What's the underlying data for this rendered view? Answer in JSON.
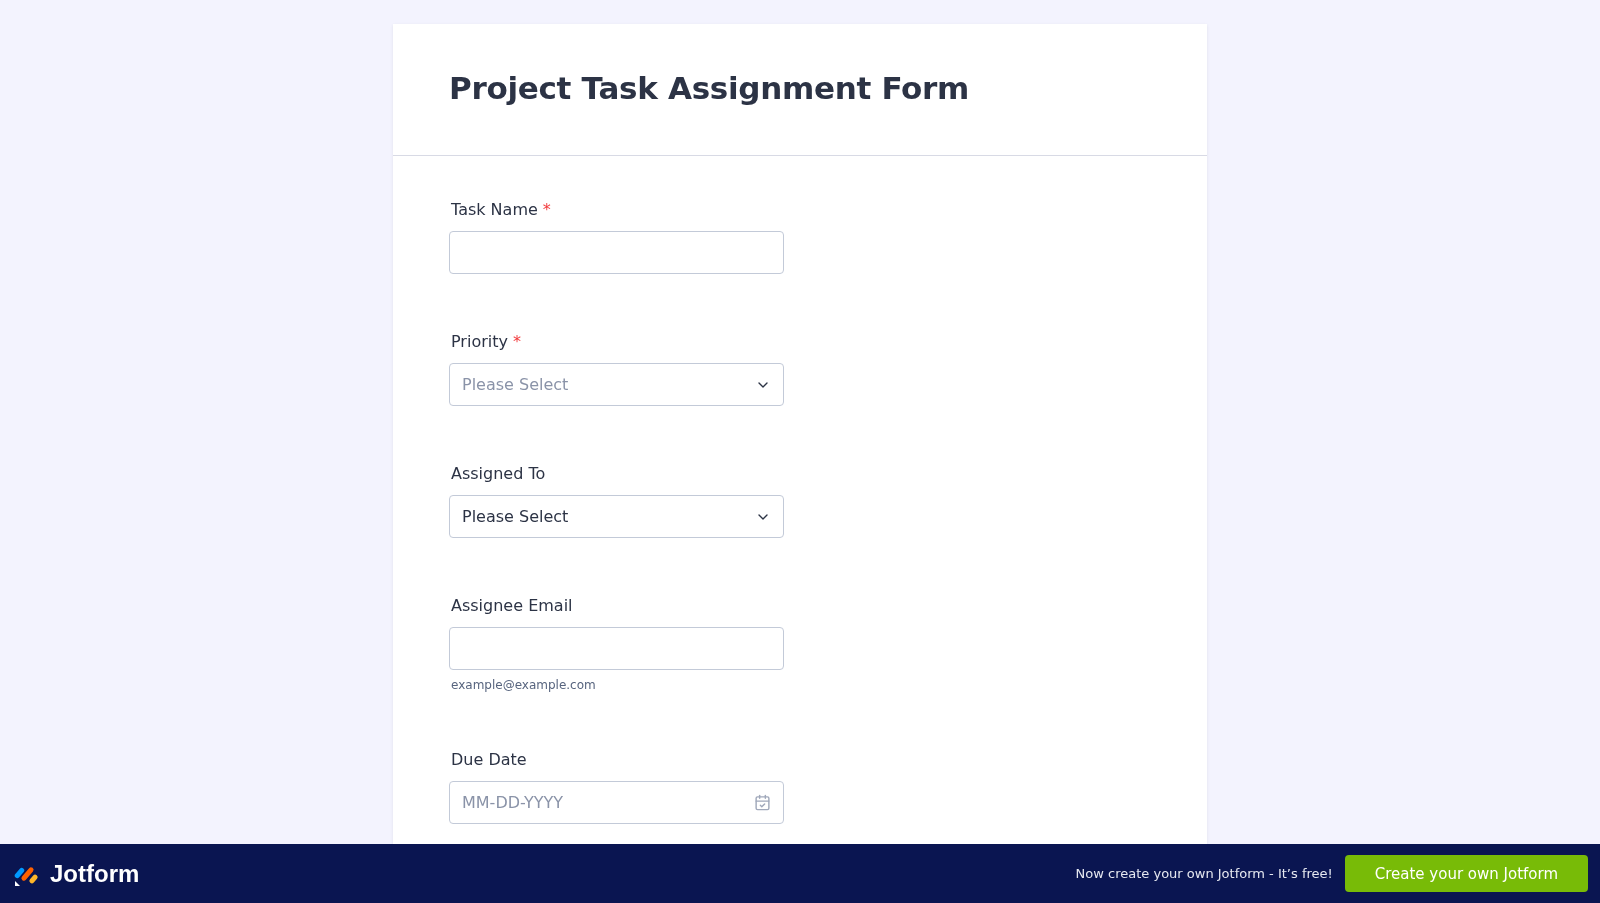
{
  "form": {
    "title": "Project Task Assignment Form",
    "fields": [
      {
        "kind": "text",
        "label": "Task Name",
        "required_mark": "*"
      },
      {
        "kind": "select",
        "label": "Priority",
        "required_mark": "*",
        "placeholder": "Please Select"
      },
      {
        "kind": "select",
        "label": "Assigned To",
        "value": "Please Select"
      },
      {
        "kind": "email",
        "label": "Assignee Email",
        "sublabel": "example@example.com"
      },
      {
        "kind": "date",
        "label": "Due Date",
        "placeholder": "MM-DD-YYYY"
      }
    ]
  },
  "footer": {
    "brand": "Jotform",
    "tagline": "Now create your own Jotform - It’s free!",
    "button": "Create your own Jotform"
  }
}
